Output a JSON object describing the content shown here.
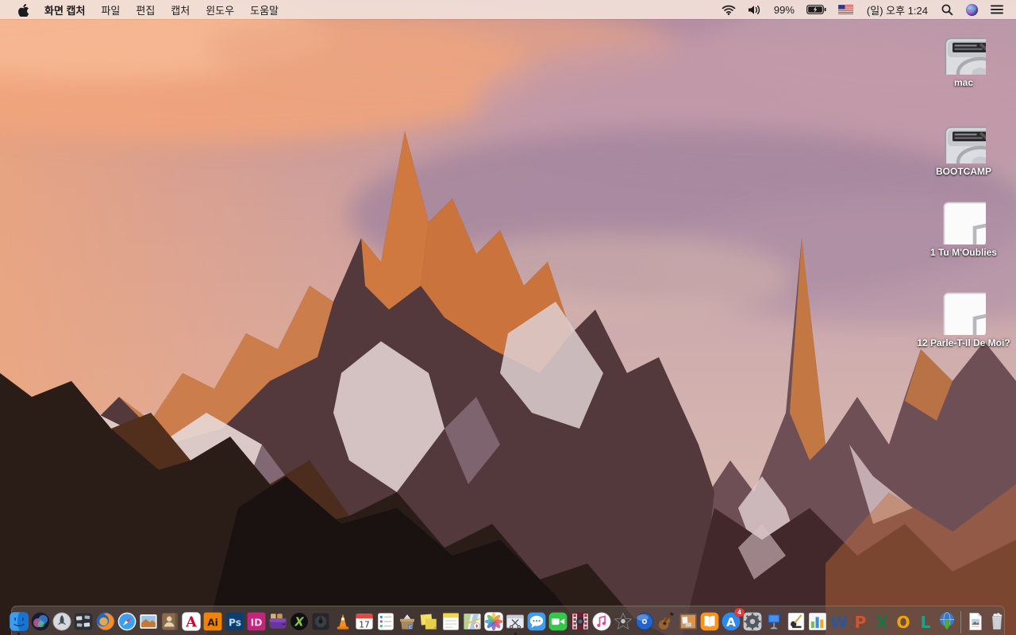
{
  "menu_bar": {
    "app_name": "화면 캡처",
    "menus": [
      "파일",
      "편집",
      "캡처",
      "윈도우",
      "도움말"
    ],
    "status": {
      "battery_percent": "99%",
      "clock": "(일) 오후 1:24",
      "icons": [
        "wifi",
        "volume",
        "battery-charging",
        "us-flag",
        "spotlight",
        "siri",
        "notification-center"
      ]
    }
  },
  "desktop": {
    "icons": [
      {
        "id": "drive-mac",
        "kind": "hard-drive",
        "label": "mac"
      },
      {
        "id": "drive-bootcamp",
        "kind": "hard-drive",
        "label": "BOOTCAMP"
      },
      {
        "id": "audio-tu-moublies",
        "kind": "audio-file",
        "label": "1 Tu M'Oublies"
      },
      {
        "id": "audio-parle-t-il",
        "kind": "audio-file",
        "label": "12 Parle-T-Il De Moi?"
      }
    ]
  },
  "dock": {
    "items": [
      {
        "id": "finder",
        "label": "Finder",
        "running": true
      },
      {
        "id": "siri",
        "label": "Siri"
      },
      {
        "id": "launchpad",
        "label": "Launchpad"
      },
      {
        "id": "mission-control",
        "label": "Mission Control"
      },
      {
        "id": "firefox",
        "label": "Firefox"
      },
      {
        "id": "safari",
        "label": "Safari"
      },
      {
        "id": "preview",
        "label": "Preview"
      },
      {
        "id": "contacts",
        "label": "Contacts"
      },
      {
        "id": "acrobat",
        "label": "Adobe Acrobat Reader",
        "text": "A"
      },
      {
        "id": "illustrator",
        "label": "Adobe Illustrator",
        "text": "Ai"
      },
      {
        "id": "photoshop",
        "label": "Adobe Photoshop",
        "text": "Ps"
      },
      {
        "id": "indesign",
        "label": "Adobe InDesign",
        "text": "ID"
      },
      {
        "id": "toast",
        "label": "Toast"
      },
      {
        "id": "divx",
        "label": "DivX",
        "text": "X"
      },
      {
        "id": "disk-tool",
        "label": "Disk Tool"
      },
      {
        "id": "vlc",
        "label": "VLC"
      },
      {
        "id": "calendar",
        "label": "Calendar",
        "day": "17"
      },
      {
        "id": "reminders",
        "label": "Reminders"
      },
      {
        "id": "archive-utility",
        "label": "Archive Utility",
        "text": "C"
      },
      {
        "id": "stickies",
        "label": "Stickies"
      },
      {
        "id": "notes",
        "label": "Notes"
      },
      {
        "id": "maps",
        "label": "Maps"
      },
      {
        "id": "photos",
        "label": "Photos"
      },
      {
        "id": "screen-capture",
        "label": "화면 캡처",
        "running": true
      },
      {
        "id": "messages",
        "label": "Messages"
      },
      {
        "id": "facetime",
        "label": "FaceTime"
      },
      {
        "id": "photo-booth",
        "label": "Photo Booth"
      },
      {
        "id": "itunes",
        "label": "iTunes"
      },
      {
        "id": "imovie",
        "label": "iMovie"
      },
      {
        "id": "idvd",
        "label": "iDVD"
      },
      {
        "id": "garageband",
        "label": "GarageBand"
      },
      {
        "id": "pinboard",
        "label": "Pinboard"
      },
      {
        "id": "ibooks",
        "label": "iBooks"
      },
      {
        "id": "app-store",
        "label": "App Store",
        "text": "A",
        "badge": "4"
      },
      {
        "id": "system-preferences",
        "label": "System Preferences"
      },
      {
        "id": "keynote",
        "label": "Keynote"
      },
      {
        "id": "pages",
        "label": "Pages"
      },
      {
        "id": "numbers",
        "label": "Numbers"
      },
      {
        "id": "word",
        "label": "Microsoft Word",
        "text": "W"
      },
      {
        "id": "powerpoint",
        "label": "Microsoft PowerPoint",
        "text": "P"
      },
      {
        "id": "excel",
        "label": "Microsoft Excel",
        "text": "X"
      },
      {
        "id": "outlook",
        "label": "Microsoft Outlook",
        "text": "O"
      },
      {
        "id": "lync",
        "label": "Microsoft Lync",
        "text": "L"
      },
      {
        "id": "downloader",
        "label": "Download Manager"
      },
      {
        "id": "document",
        "label": "Document",
        "section": "files"
      },
      {
        "id": "trash",
        "label": "Trash",
        "section": "files"
      }
    ]
  }
}
